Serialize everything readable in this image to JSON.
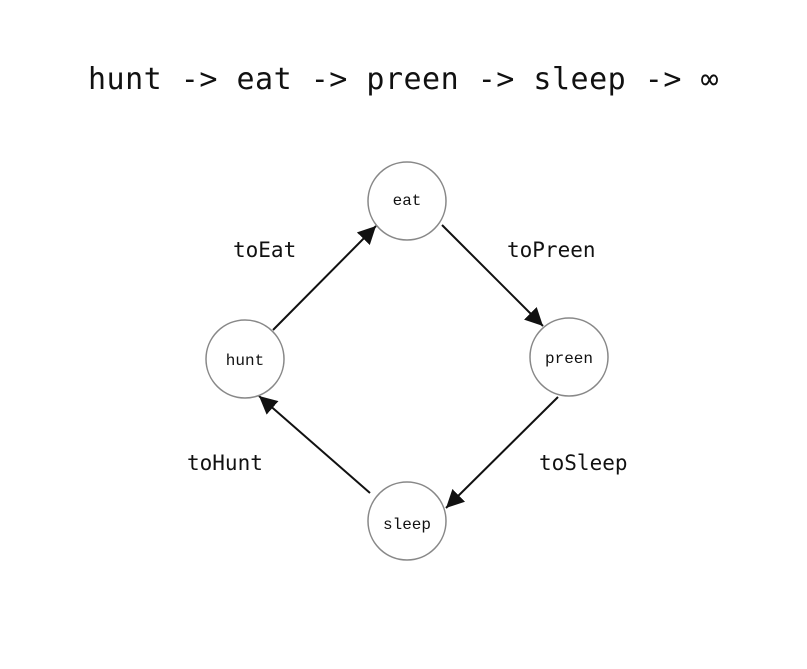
{
  "title": "hunt -> eat -> preen -> sleep -> ∞",
  "nodes": [
    {
      "id": "hunt",
      "label": "hunt"
    },
    {
      "id": "eat",
      "label": "eat"
    },
    {
      "id": "preen",
      "label": "preen"
    },
    {
      "id": "sleep",
      "label": "sleep"
    }
  ],
  "edges": [
    {
      "from": "hunt",
      "to": "eat",
      "label": "toEat"
    },
    {
      "from": "eat",
      "to": "preen",
      "label": "toPreen"
    },
    {
      "from": "preen",
      "to": "sleep",
      "label": "toSleep"
    },
    {
      "from": "sleep",
      "to": "hunt",
      "label": "toHunt"
    }
  ]
}
